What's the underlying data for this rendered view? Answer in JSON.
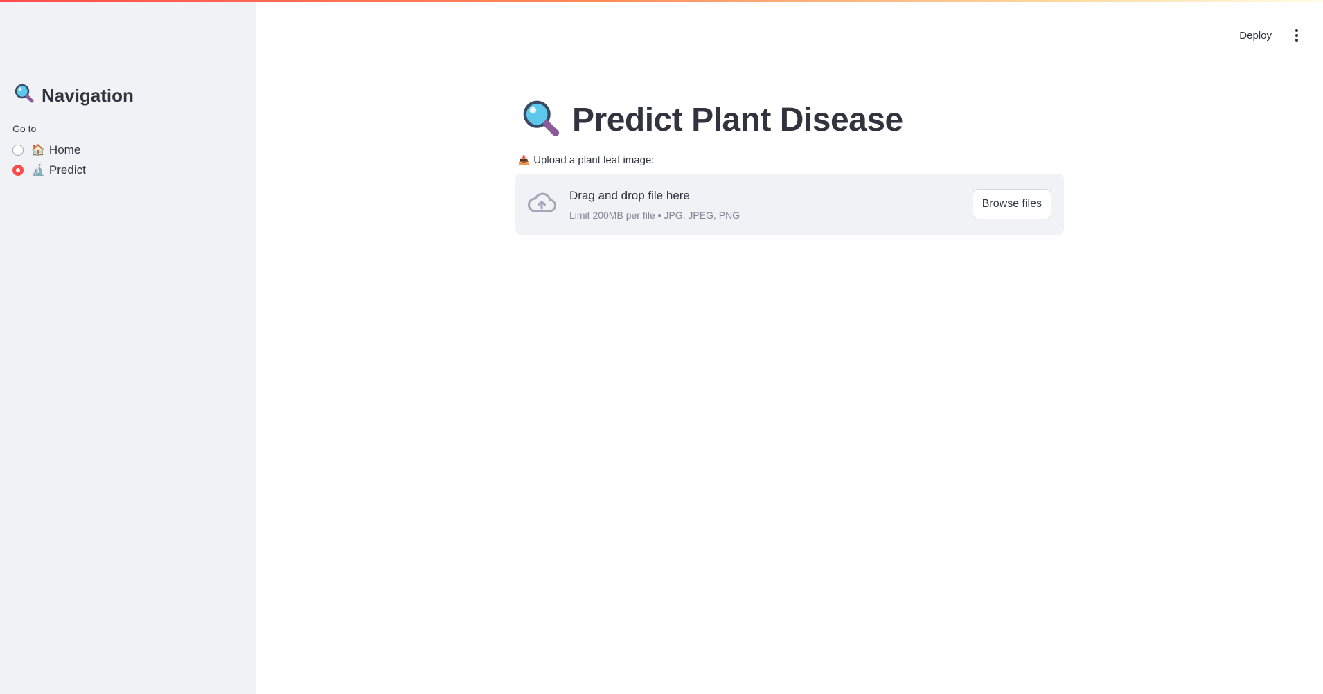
{
  "sidebar": {
    "title_icon": "magnifying-glass-icon",
    "title": "Navigation",
    "radio_label": "Go to",
    "options": [
      {
        "label": "Home",
        "icon": "house-icon",
        "emoji": "🏠",
        "selected": false
      },
      {
        "label": "Predict",
        "icon": "microscope-icon",
        "emoji": "🔬",
        "selected": true
      }
    ]
  },
  "header": {
    "deploy_label": "Deploy",
    "menu_icon": "kebab-menu-icon"
  },
  "main": {
    "title_icon": "magnifying-glass-icon",
    "title": "Predict Plant Disease",
    "uploader": {
      "label_icon": "inbox-tray-icon",
      "label_emoji": "📥",
      "label": "Upload a plant leaf image:",
      "dropzone_icon": "cloud-upload-icon",
      "dropzone_title": "Drag and drop file here",
      "dropzone_limit": "Limit 200MB per file • JPG, JPEG, PNG",
      "browse_label": "Browse files"
    }
  },
  "colors": {
    "accent": "#ff4b4b",
    "sidebar_bg": "#f0f2f6",
    "text": "#31333f",
    "muted_text": "#808495"
  }
}
